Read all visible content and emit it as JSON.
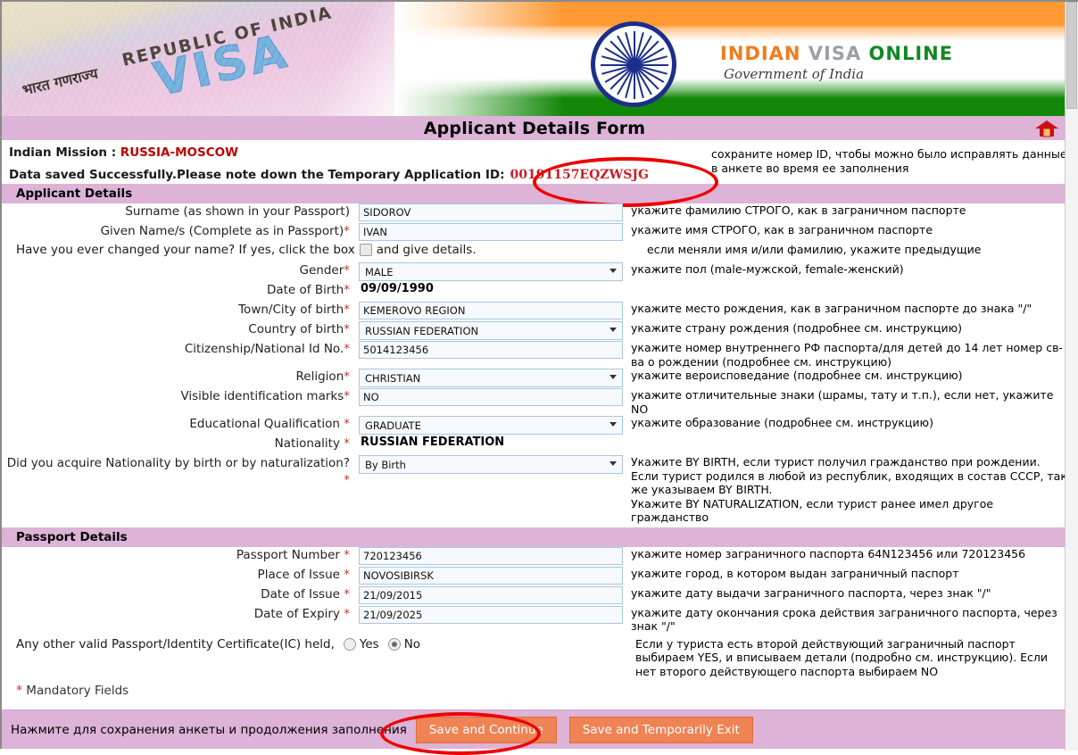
{
  "banner": {
    "visa_word": "VISA",
    "republic_word": "REPUBLIC OF INDIA",
    "hindi_word": "भारत गणराज्य",
    "logo_indian": "INDIAN",
    "logo_visa": "VISA",
    "logo_online": "ONLINE",
    "logo_subtitle": "Government of India",
    "emblem_icon": "ashoka-chakra-icon"
  },
  "titlebar": {
    "title": "Applicant Details Form",
    "home_icon": "home-icon"
  },
  "info": {
    "mission_label": "Indian Mission : ",
    "mission_value": "RUSSIA-MOSCOW",
    "saved_text": "Data saved Successfully.Please note down the Temporary Application ID:",
    "temp_id": "00191157EQZWSJG",
    "ru_note_top": "сохраните номер ID, чтобы можно было исправлять данные в анкете во время ее заполнения",
    "highlight_color": "#ee0000"
  },
  "sections": {
    "applicant": "Applicant Details",
    "passport": "Passport Details"
  },
  "applicant_fields": [
    {
      "label": "Surname (as shown in your Passport)",
      "required": false,
      "type": "text",
      "value": "SIDOROV",
      "hint": "укажите фамилию СТРОГО, как в заграничном паспорте",
      "name": "surname"
    },
    {
      "label": "Given Name/s (Complete as in Passport)",
      "required": true,
      "type": "text",
      "value": "IVAN",
      "hint": "укажите имя СТРОГО, как в заграничном паспорте",
      "name": "given-name"
    },
    {
      "label": "Gender",
      "required": true,
      "type": "select",
      "value": "MALE",
      "hint": "укажите пол (male-мужской, female-женский)",
      "name": "gender"
    },
    {
      "label": "Date of Birth",
      "required": true,
      "type": "static",
      "value": "09/09/1990",
      "hint": "",
      "name": "date-of-birth"
    },
    {
      "label": "Town/City of birth",
      "required": true,
      "type": "text",
      "value": "KEMEROVO REGION",
      "hint": "укажите место рождения, как в заграничном паспорте до знака \"/\"",
      "name": "town-city-of-birth"
    },
    {
      "label": "Country of birth",
      "required": true,
      "type": "select",
      "value": "RUSSIAN FEDERATION",
      "hint": "укажите страну рождения (подробнее см. инструкцию)",
      "name": "country-of-birth"
    },
    {
      "label": "Citizenship/National Id No.",
      "required": true,
      "type": "text",
      "value": "5014123456",
      "hint": "укажите номер внутреннего РФ паспорта/для детей до 14 лет номер св-ва о рождении (подробнее см. инструкцию)",
      "name": "citizenship-national-id"
    },
    {
      "label": "Religion",
      "required": true,
      "type": "select",
      "value": "CHRISTIAN",
      "hint": "укажите вероисповедание (подробнее см. инструкцию)",
      "name": "religion"
    },
    {
      "label": "Visible identification marks",
      "required": true,
      "type": "text",
      "value": "NO",
      "hint": "укажите отличительные знаки (шрамы, тату и т.п.), если нет, укажите NO",
      "name": "visible-identification-marks"
    },
    {
      "label": "Educational Qualification ",
      "required": true,
      "type": "select",
      "value": "GRADUATE",
      "hint": "укажите образование (подробнее см. инструкцию)",
      "name": "educational-qualification"
    },
    {
      "label": "Nationality ",
      "required": true,
      "type": "static",
      "value": "RUSSIAN FEDERATION",
      "hint": "",
      "name": "nationality"
    },
    {
      "label": "Did you acquire Nationality by birth or by naturalization? ",
      "required": true,
      "type": "select",
      "value": "By Birth",
      "hint": "Укажите BY BIRTH, если турист получил гражданство при рождении.\nЕсли турист родился в любой из республик, входящих в состав СССР, так же указываем BY BIRTH.\nУкажите BY NATURALIZATION, если турист ранее имел другое гражданство",
      "name": "nationality-acquired"
    }
  ],
  "name_change": {
    "text_before": "Have you ever changed your name? If yes, click the box",
    "text_after": "and give details.",
    "checked": false,
    "hint": "если меняли имя и/или фамилию, укажите предыдущие"
  },
  "passport_fields": [
    {
      "label": "Passport Number ",
      "required": true,
      "type": "text",
      "value": "720123456",
      "hint": "укажите номер заграничного паспорта 64N123456 или 720123456",
      "name": "passport-number"
    },
    {
      "label": "Place of Issue ",
      "required": true,
      "type": "text",
      "value": "NOVOSIBIRSK",
      "hint": "укажите город, в котором выдан заграничный паспорт",
      "name": "place-of-issue"
    },
    {
      "label": "Date of Issue ",
      "required": true,
      "type": "text",
      "value": "21/09/2015",
      "hint": "укажите дату выдачи заграничного паспорта, через знак \"/\"",
      "name": "date-of-issue"
    },
    {
      "label": "Date of Expiry ",
      "required": true,
      "type": "text",
      "value": "21/09/2025",
      "hint": "укажите дату окончания срока действия заграничного паспорта, через знак \"/\"",
      "name": "date-of-expiry"
    }
  ],
  "other_passport": {
    "text": "Any other valid Passport/Identity Certificate(IC) held,",
    "yes_label": "Yes",
    "no_label": "No",
    "selected": "No",
    "hint": "Если у туриста есть второй действующий заграничный паспорт выбираем YES, и вписываем детали (подробно см. инструкцию). Если нет второго действующего паспорта выбираем NO"
  },
  "mandatory_note": "Mandatory Fields",
  "bottom": {
    "text": "Нажмите для сохранения анкеты и продолжения заполнения",
    "save_continue": "Save and Continue",
    "save_exit": "Save and Temporarily Exit",
    "button_color": "#ef8354"
  }
}
